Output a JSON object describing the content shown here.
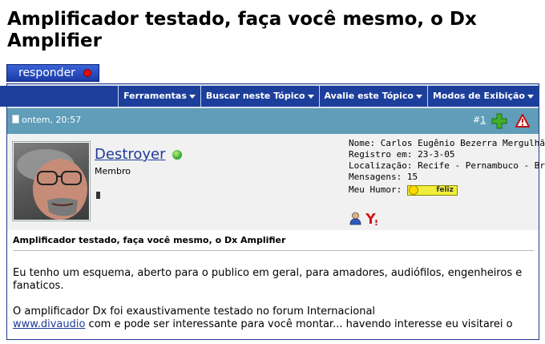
{
  "thread": {
    "title": "Amplificador testado, faça você mesmo, o Dx Amplifier"
  },
  "reply_button": {
    "label": "responder"
  },
  "toolbar": {
    "items": [
      {
        "label": "Ferramentas"
      },
      {
        "label": "Buscar neste Tópico"
      },
      {
        "label": "Avalie este Tópico"
      },
      {
        "label": "Modos de Exibição"
      }
    ]
  },
  "post": {
    "date": "ontem, 20:57",
    "number_prefix": "#",
    "number": "1",
    "user": {
      "name": "Destroyer",
      "title": "Membro",
      "details": {
        "nome": "Nome: Carlos Eugênio Bezerra Mergulhão",
        "registro": "Registro em: 23-3-05",
        "localizacao": "Localização: Recife - Pernambuco - Brasil",
        "mensagens": "Mensagens: 15",
        "humor_label": "Meu Humor:",
        "humor_value": "feliz"
      }
    },
    "message_title": "Amplificador testado, faça você mesmo, o Dx Amplifier",
    "paragraph1": "Eu tenho um esquema, aberto para o publico em geral, para amadores, audiófilos, engenheiros e fanaticos.",
    "paragraph2_line1": "O amplificador Dx foi exaustivamente testado no forum Internacional",
    "paragraph2_link": "www.divaudio",
    "paragraph2_rest": " com e pode ser interessante para você montar... havendo interesse eu visitarei o"
  },
  "colors": {
    "toolbar_blue": "#1d3f9c",
    "header_teal": "#5f9db9",
    "link_blue": "#1f3a9a",
    "online_green": "#2aa02a",
    "reply_dot_red": "#e01010"
  },
  "icons": {
    "add": "plus-icon",
    "report": "warning-icon",
    "profile": "user-icon",
    "yahoo": "yahoo-icon"
  }
}
